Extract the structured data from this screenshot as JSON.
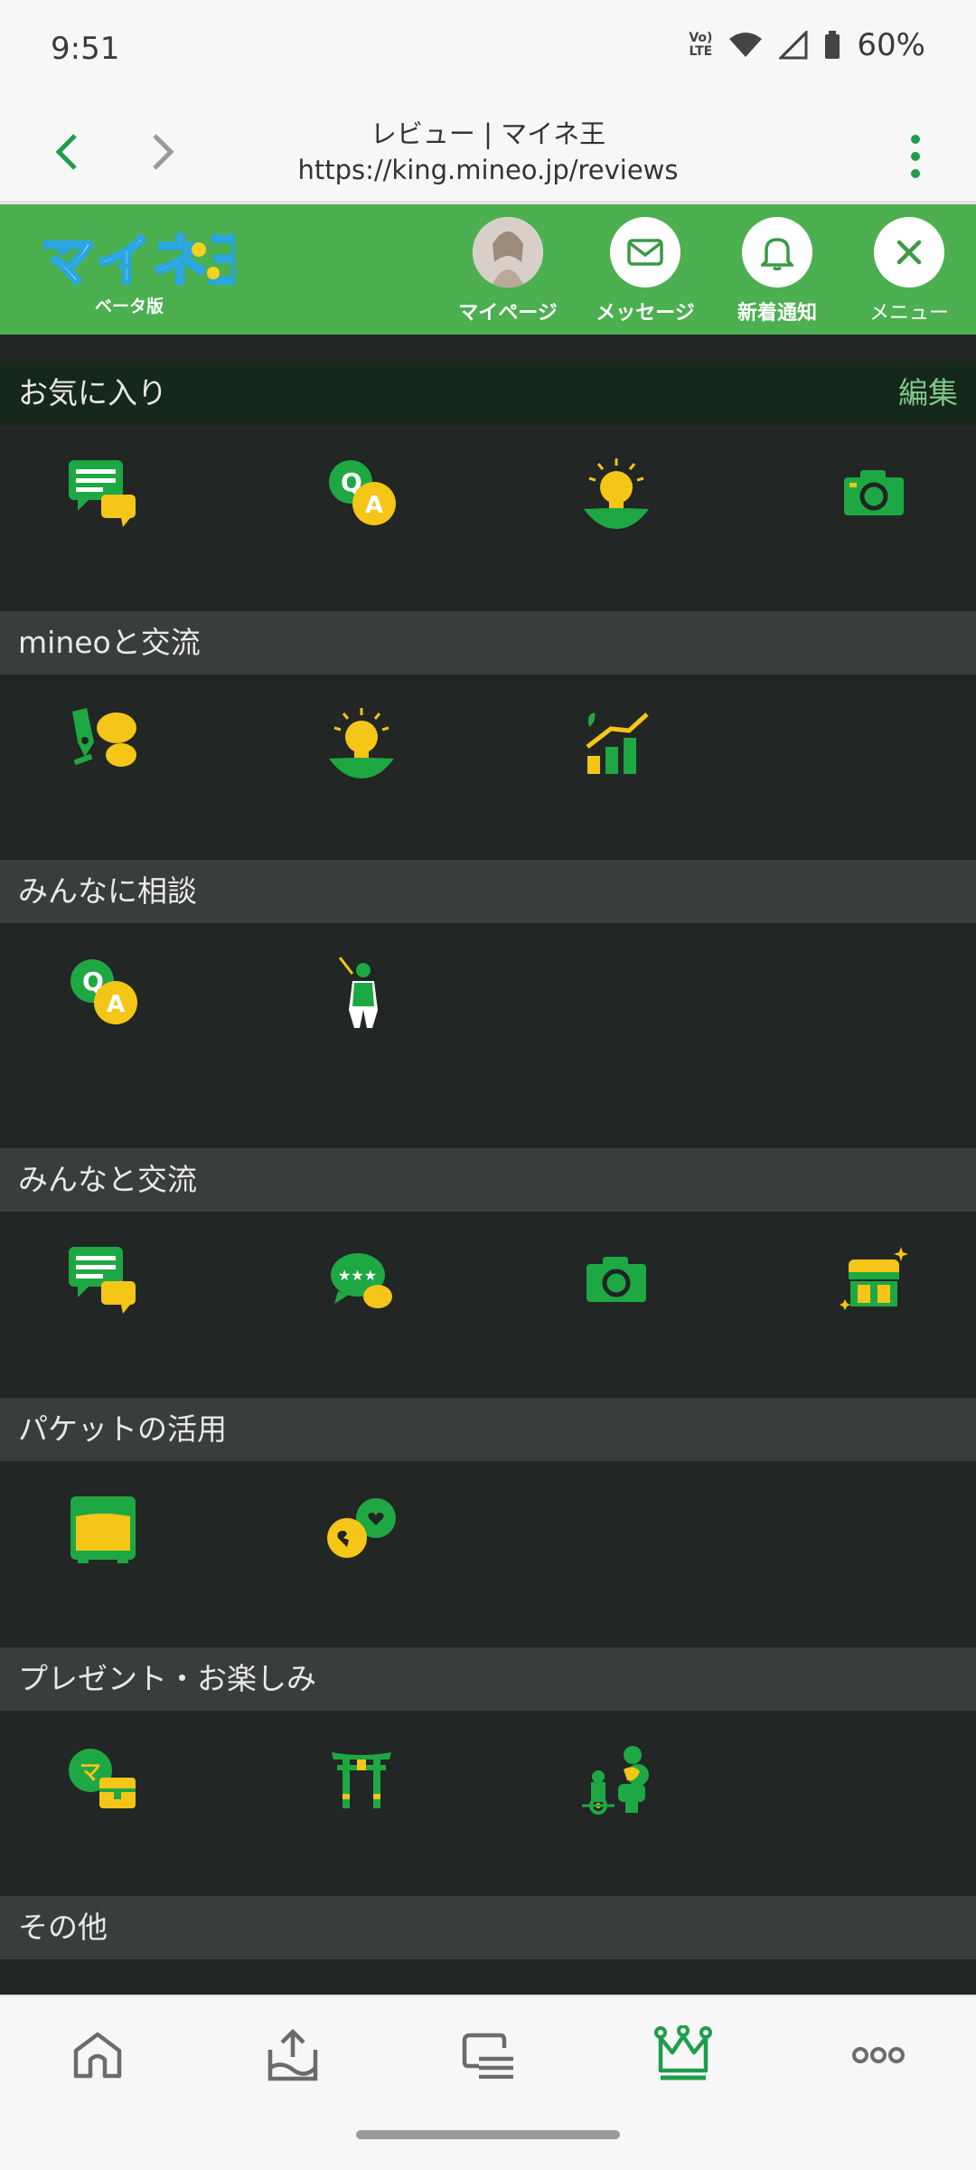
{
  "status_bar": {
    "time": "9:51",
    "volte_line1": "Vo)",
    "volte_line2": "LTE",
    "battery": "60%"
  },
  "browser": {
    "page_title": "レビュー | マイネ王",
    "url": "https://king.mineo.jp/reviews"
  },
  "site_header": {
    "logo_text": "マイネ王",
    "logo_sub": "ベータ版",
    "mypage_label": "マイページ",
    "message_label": "メッセージ",
    "notify_label": "新着通知",
    "menu_label": "メニュー"
  },
  "sections": {
    "favorites": {
      "title": "お気に入り",
      "edit": "編集"
    },
    "mineo": {
      "title": "mineoと交流"
    },
    "consult": {
      "title": "みんなに相談"
    },
    "community": {
      "title": "みんなと交流"
    },
    "packet": {
      "title": "パケットの活用"
    },
    "present": {
      "title": "プレゼント・お楽しみ"
    },
    "other": {
      "title": "その他"
    }
  },
  "colors": {
    "brand_green": "#4caf50",
    "icon_green": "#1ea843",
    "icon_yellow": "#f5c518"
  },
  "icons": [
    "review-icon",
    "qa-icon",
    "idea-icon",
    "camera-icon",
    "pen-chat-icon",
    "idea-icon",
    "growth-chart-icon",
    "qa-icon",
    "explorer-icon",
    "review-icon",
    "rating-chat-icon",
    "camera-icon",
    "treasure-box-icon",
    "packet-tank-icon",
    "heart-chat-icon",
    "coin-gift-icon",
    "shrine-gate-icon",
    "cactus-robot-icon"
  ]
}
